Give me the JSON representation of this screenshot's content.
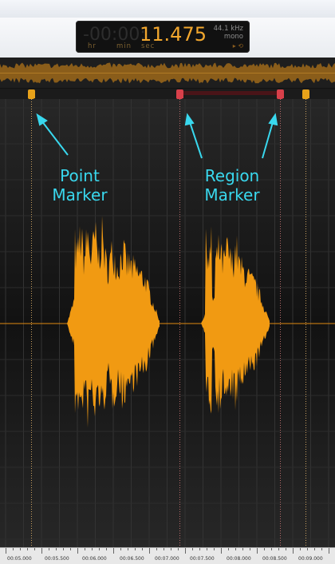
{
  "clock": {
    "ghost_digits": "-00:00:",
    "time": "11.475",
    "unit_hr": "hr",
    "unit_min": "min",
    "unit_sec": "sec",
    "sample_rate": "44.1 kHz",
    "channels": "mono",
    "loop_glyph": "▸ ⟲"
  },
  "annotations": {
    "point_marker_line1": "Point",
    "point_marker_line2": "Marker",
    "region_marker_line1": "Region",
    "region_marker_line2": "Marker"
  },
  "ruler": {
    "labels": [
      "00:05.000",
      "00:05.500",
      "00:06.000",
      "00:06.500",
      "00:07.000",
      "00:07.500",
      "00:08.000",
      "00:08.500",
      "00:09.000"
    ]
  },
  "colors": {
    "waveform": "#f19a12",
    "annotation": "#39d8ee",
    "point_marker": "#e8a21a",
    "region_marker": "#d8404a",
    "clock_digits": "#f2a72e"
  }
}
